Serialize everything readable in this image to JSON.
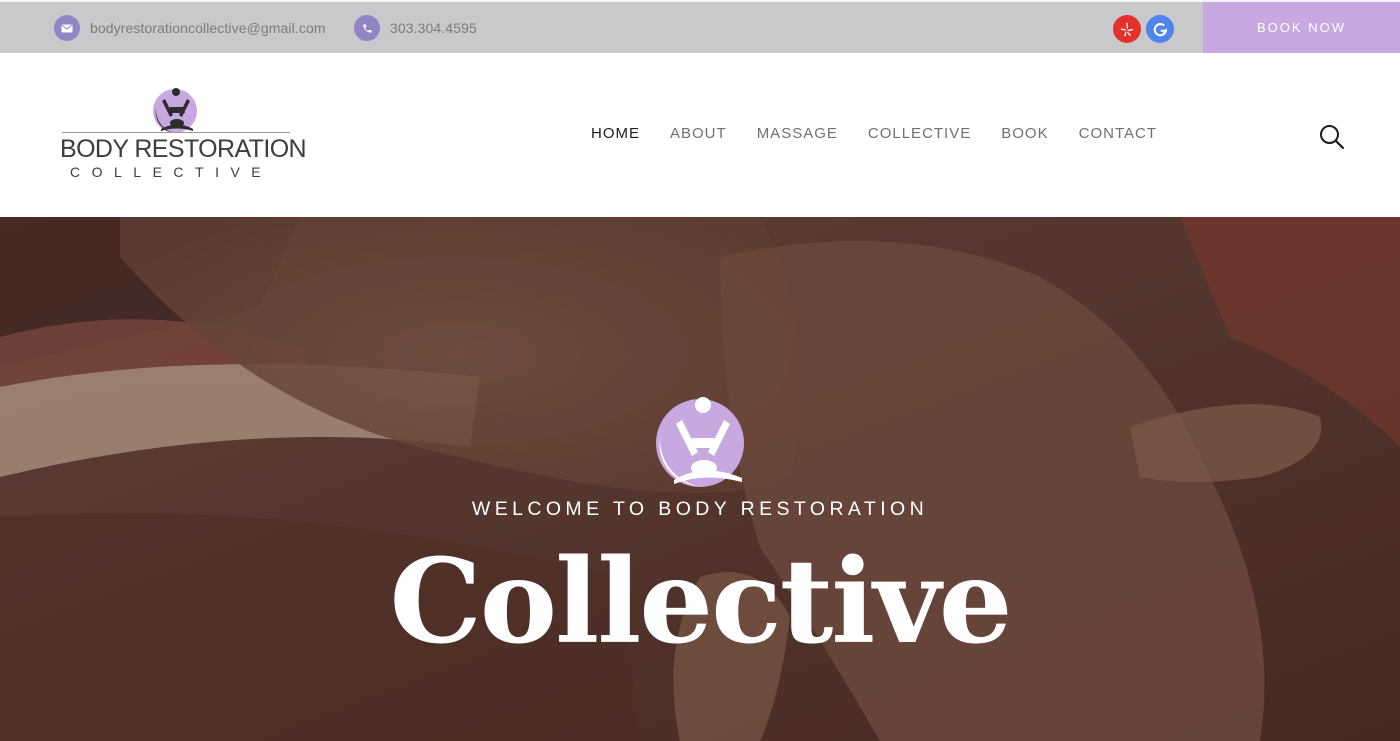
{
  "topbar": {
    "email": "bodyrestorationcollective@gmail.com",
    "phone": "303.304.4595",
    "book_now": "BOOK NOW",
    "icons": {
      "email": "envelope-icon",
      "phone": "phone-icon",
      "yelp": "yelp-icon",
      "google": "google-icon"
    },
    "colors": {
      "bar": "#c9c9cb",
      "icon_circle": "#9285c4",
      "book_now": "#c7a8e1",
      "yelp": "#e3312c",
      "google": "#4f85ec"
    }
  },
  "logo": {
    "main": "BODY RESTORATION",
    "sub": "COLLECTIVE"
  },
  "nav": {
    "items": [
      {
        "label": "HOME",
        "active": true
      },
      {
        "label": "ABOUT",
        "active": false
      },
      {
        "label": "MASSAGE",
        "active": false
      },
      {
        "label": "COLLECTIVE",
        "active": false
      },
      {
        "label": "BOOK",
        "active": false
      },
      {
        "label": "CONTACT",
        "active": false
      }
    ],
    "search_icon": "search-icon"
  },
  "hero": {
    "subtitle": "WELCOME TO BODY RESTORATION",
    "title": "Collective",
    "accent": "#c7a8e1"
  }
}
